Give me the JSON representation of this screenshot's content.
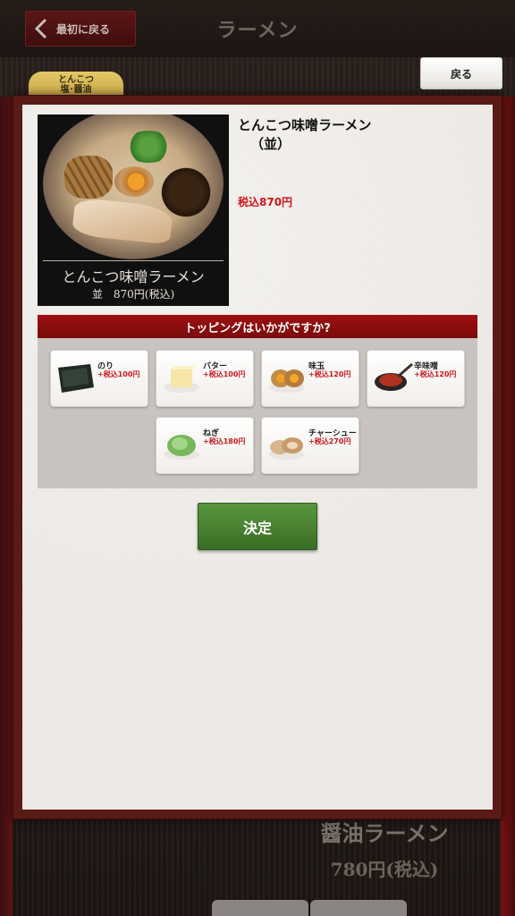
{
  "app": {
    "back_first_label": "最初に戻る",
    "title": "ラーメン",
    "tab_label_line1": "とんこつ",
    "tab_label_line2": "塩･醤油",
    "back_label": "戻る"
  },
  "background_product": {
    "name": "醤油ラーメン",
    "price": "780円(税込)"
  },
  "modal": {
    "image_caption_name": "とんこつ味噌ラーメン",
    "image_caption_price": "並　870円(税込)",
    "product_title": "とんこつ味噌ラーメン",
    "product_size": "（並）",
    "product_price": "税込870円",
    "topping_header": "トッピングはいかがですか?",
    "toppings": [
      {
        "name": "のり",
        "price": "+税込100円",
        "icon": "nori-icon"
      },
      {
        "name": "バター",
        "price": "+税込100円",
        "icon": "butter-icon"
      },
      {
        "name": "味玉",
        "price": "+税込120円",
        "icon": "egg-icon"
      },
      {
        "name": "辛味噌",
        "price": "+税込120円",
        "icon": "spicy-miso-icon"
      },
      {
        "name": "ねぎ",
        "price": "+税込180円",
        "icon": "negi-icon"
      },
      {
        "name": "チャーシュー",
        "price": "+税込270円",
        "icon": "chashu-icon"
      }
    ],
    "decide_label": "決定"
  },
  "colors": {
    "accent_red": "#7a0b0b",
    "price_red": "#d4141a",
    "decide_green": "#4a7f31"
  }
}
